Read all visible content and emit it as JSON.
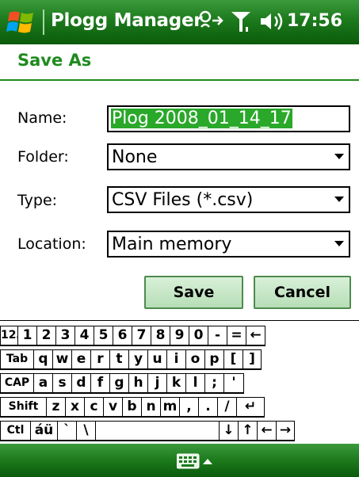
{
  "titlebar": {
    "start_icon": "windows-flag-icon",
    "app_title": "Plogg Manager",
    "status_icons": [
      "connectivity-icon",
      "signal-icon",
      "volume-icon"
    ],
    "time": "17:56"
  },
  "page": {
    "heading": "Save As"
  },
  "form": {
    "name_label": "Name:",
    "name_value": "Plog 2008_01_14_17",
    "folder_label": "Folder:",
    "folder_value": "None",
    "type_label": "Type:",
    "type_value": "CSV Files (*.csv)",
    "location_label": "Location:",
    "location_value": "Main memory"
  },
  "buttons": {
    "save": "Save",
    "cancel": "Cancel"
  },
  "keyboard": {
    "rows": [
      [
        "123",
        "1",
        "2",
        "3",
        "4",
        "5",
        "6",
        "7",
        "8",
        "9",
        "0",
        "-",
        "=",
        "←"
      ],
      [
        "Tab",
        "q",
        "w",
        "e",
        "r",
        "t",
        "y",
        "u",
        "i",
        "o",
        "p",
        "[",
        "]"
      ],
      [
        "CAP",
        "a",
        "s",
        "d",
        "f",
        "g",
        "h",
        "j",
        "k",
        "l",
        ";",
        "'"
      ],
      [
        "Shift",
        "z",
        "x",
        "c",
        "v",
        "b",
        "n",
        "m",
        ",",
        ".",
        "/",
        "↵"
      ],
      [
        "Ctl",
        "áü",
        "`",
        "\\",
        " ",
        "↓",
        "↑",
        "←",
        "→"
      ]
    ]
  },
  "bottombar": {
    "sip_icon": "keyboard-icon",
    "sip_menu_icon": "up-arrow-icon"
  },
  "colors": {
    "accent": "#1f8a1f",
    "bar": "#1c7a1c",
    "button": "#c8e8c8"
  }
}
